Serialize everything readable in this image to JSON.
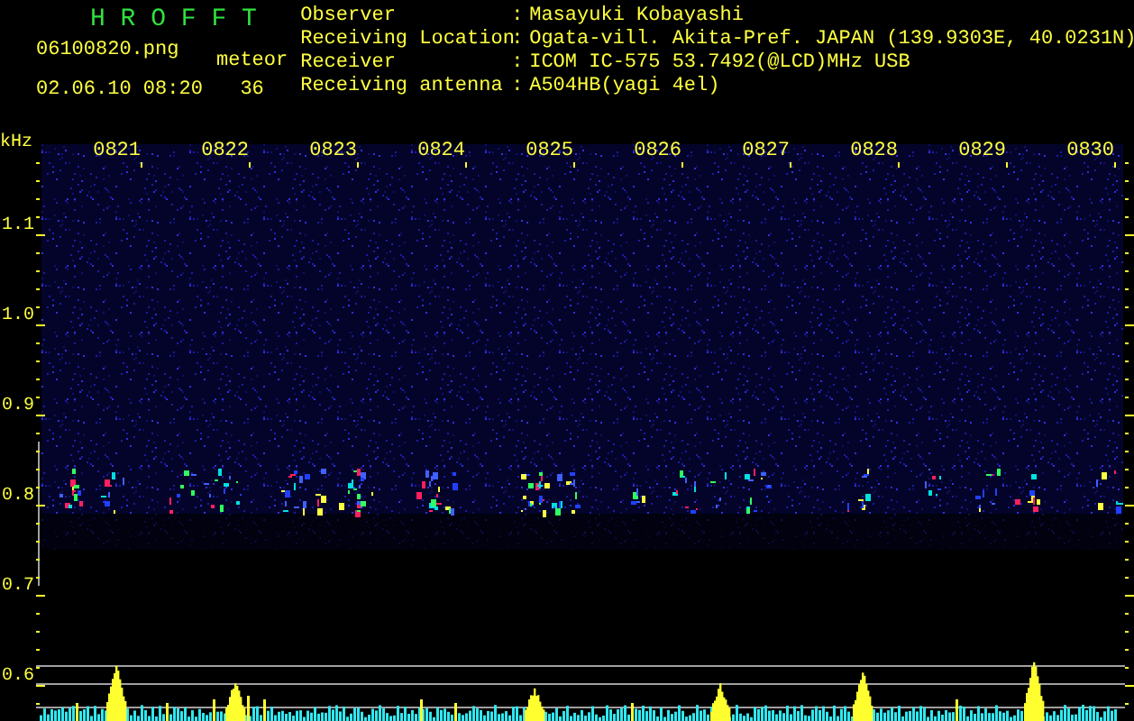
{
  "title": "H R O F F T",
  "file_name": "06100820.png",
  "timestamp": "02.06.10 08:20",
  "meteor_count": {
    "label": "meteor",
    "value": "36"
  },
  "station_info": [
    {
      "label": "Observer",
      "separator": ":",
      "value": "Masayuki Kobayashi"
    },
    {
      "label": "Receiving Location",
      "separator": ":",
      "value": "Ogata-vill. Akita-Pref. JAPAN (139.9303E, 40.0231N)"
    },
    {
      "label": "Receiver",
      "separator": ":",
      "value": "ICOM IC-575 53.7492(@LCD)MHz USB"
    },
    {
      "label": "Receiving antenna",
      "separator": ":",
      "value": "A504HB(yagi 4el)"
    }
  ],
  "spectrogram": {
    "unit": "kHz",
    "frequency_labels": [
      "1.1",
      "1.0",
      "0.9",
      "0.8",
      "0.7",
      "0.6"
    ],
    "time_labels": [
      "0821",
      "0822",
      "0823",
      "0824",
      "0825",
      "0826",
      "0827",
      "0828",
      "0829",
      "0830"
    ]
  }
}
